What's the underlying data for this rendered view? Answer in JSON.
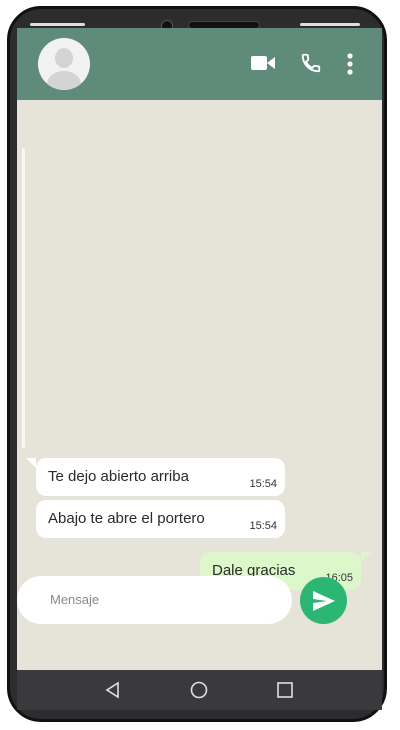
{
  "chat": {
    "messages": [
      {
        "direction": "in",
        "text": "Te dejo abierto arriba",
        "time": "15:54"
      },
      {
        "direction": "in",
        "text": "Abajo te abre el portero",
        "time": "15:54"
      },
      {
        "direction": "out",
        "text": "Dale gracias",
        "time": "16:05"
      }
    ]
  },
  "composer": {
    "placeholder": "Mensaje"
  },
  "header": {
    "icons": [
      "avatar",
      "video-icon",
      "phone-icon",
      "more-vertical-icon"
    ]
  },
  "navbar": {
    "icons": [
      "back-triangle-icon",
      "home-circle-icon",
      "recent-square-icon"
    ]
  },
  "colors": {
    "header": "#5f8b7a",
    "chat_background": "#e6e3d9",
    "incoming_bubble": "#ffffff",
    "outgoing_bubble": "#dcf7c9",
    "send_button": "#2bb673",
    "phone_frame": "#2c2c2e"
  }
}
